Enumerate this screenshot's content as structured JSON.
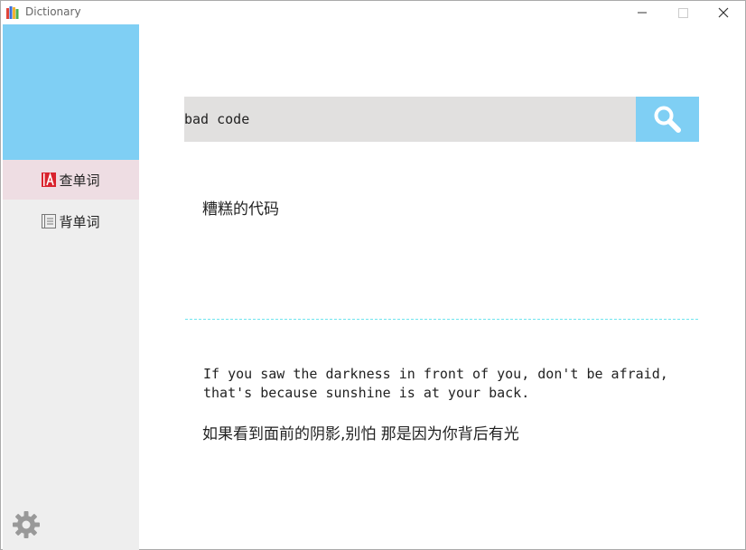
{
  "window": {
    "title": "Dictionary"
  },
  "sidebar": {
    "items": [
      {
        "label": "查单词",
        "icon": "dictionary-a-icon",
        "selected": true
      },
      {
        "label": "背单词",
        "icon": "notebook-icon",
        "selected": false
      }
    ],
    "settings_icon": "gear-icon"
  },
  "search": {
    "value": "bad code",
    "button_icon": "search-icon"
  },
  "result": {
    "translation": "糟糕的代码"
  },
  "quote": {
    "english": "If you saw the darkness in front of you, don't be afraid,\nthat's because sunshine is at your back.",
    "chinese": "如果看到面前的阴影,别怕 那是因为你背后有光"
  },
  "colors": {
    "accent": "#7fcff4",
    "sidebar_bg": "#eeeeee",
    "selected_item_bg": "#eedde3",
    "search_bg": "#e1e0df",
    "divider": "#6fe4ef"
  }
}
